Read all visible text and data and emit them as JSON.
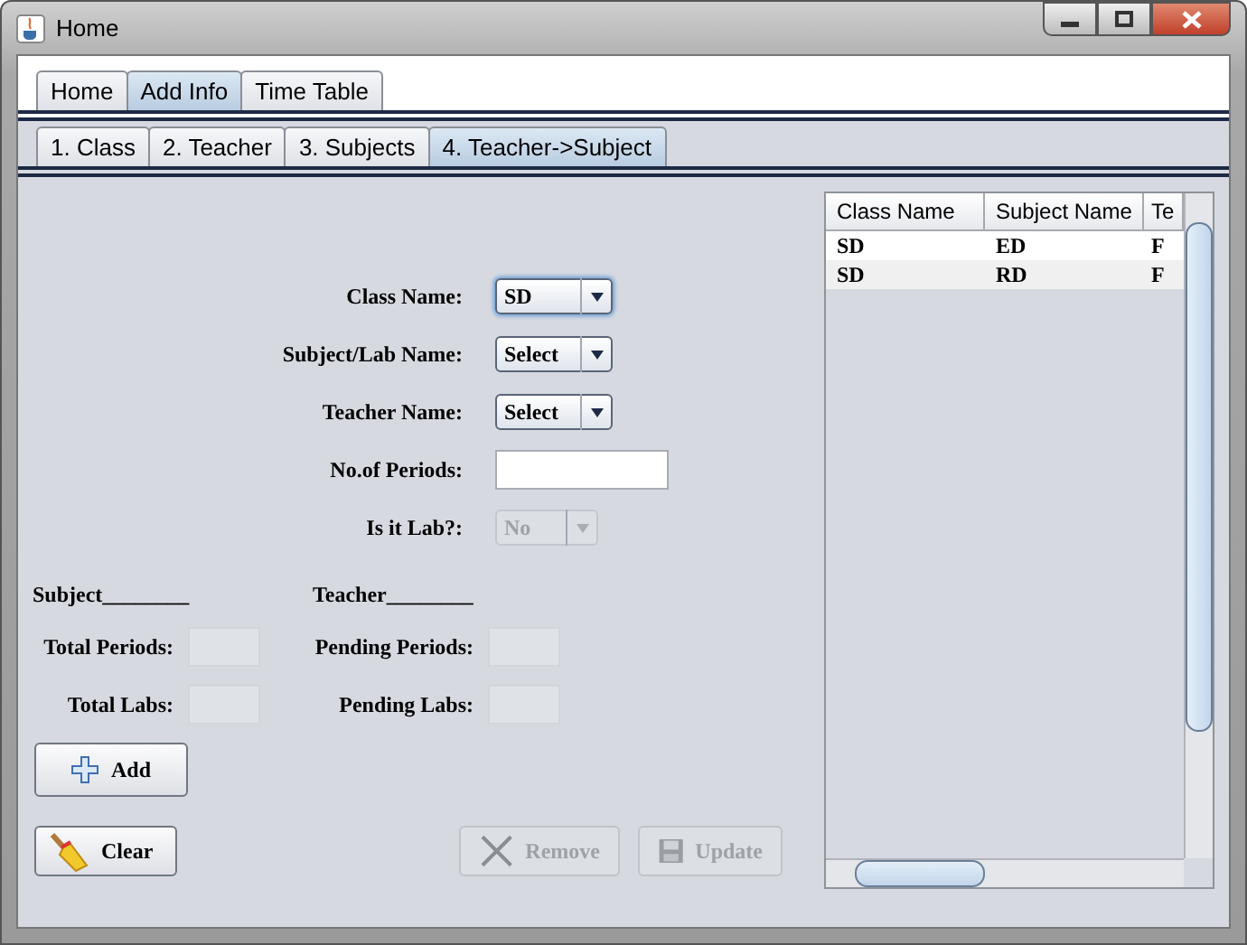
{
  "window": {
    "title": "Home"
  },
  "tabs": [
    {
      "label": "Home",
      "selected": false
    },
    {
      "label": "Add Info",
      "selected": true
    },
    {
      "label": "Time Table",
      "selected": false
    }
  ],
  "subtabs": [
    {
      "label": "1. Class",
      "selected": false
    },
    {
      "label": "2. Teacher",
      "selected": false
    },
    {
      "label": "3. Subjects",
      "selected": false
    },
    {
      "label": "4. Teacher->Subject",
      "selected": true
    }
  ],
  "form": {
    "fields": [
      {
        "label": "Class Name:",
        "kind": "combo",
        "value": "SD",
        "focused": true,
        "disabled": false
      },
      {
        "label": "Subject/Lab Name:",
        "kind": "combo",
        "value": "Select",
        "focused": false,
        "disabled": false
      },
      {
        "label": "Teacher Name:",
        "kind": "combo",
        "value": "Select",
        "focused": false,
        "disabled": false
      },
      {
        "label": "No.of Periods:",
        "kind": "text",
        "focused": false,
        "disabled": false
      },
      {
        "label": "Is it Lab?:",
        "kind": "combo",
        "value": "No",
        "focused": false,
        "disabled": true
      }
    ]
  },
  "summary": {
    "subject": "Subject________",
    "teacher": "Teacher________",
    "stats": [
      {
        "label": "Total Periods:"
      },
      {
        "label": "Pending Periods:"
      },
      {
        "label": "Total Labs:"
      },
      {
        "label": "Pending Labs:"
      }
    ]
  },
  "buttons": [
    {
      "label": "Add",
      "disabled": false
    },
    {
      "label": "Clear",
      "disabled": false
    },
    {
      "label": "Remove",
      "disabled": true
    },
    {
      "label": "Update",
      "disabled": true
    }
  ],
  "table": {
    "columns": [
      "Class Name",
      "Subject Name",
      "Te"
    ],
    "rows": [
      [
        "SD",
        "ED",
        "F"
      ],
      [
        "SD",
        "RD",
        "F"
      ]
    ]
  }
}
